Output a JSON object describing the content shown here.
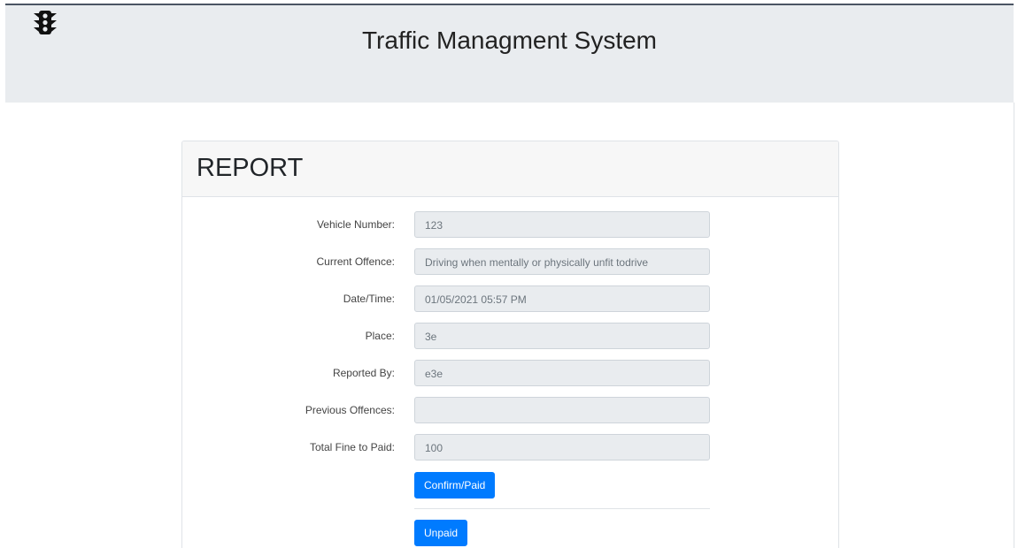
{
  "app": {
    "title": "Traffic Managment System",
    "logo_icon": "traffic-light-icon"
  },
  "report": {
    "title": "REPORT",
    "fields": [
      {
        "label": "Vehicle Number:",
        "value": "123"
      },
      {
        "label": "Current Offence:",
        "value": "Driving when mentally or physically unfit todrive"
      },
      {
        "label": "Date/Time:",
        "value": "01/05/2021 05:57 PM"
      },
      {
        "label": "Place:",
        "value": "3e"
      },
      {
        "label": "Reported By:",
        "value": "e3e"
      },
      {
        "label": "Previous Offences:",
        "value": ""
      },
      {
        "label": "Total Fine to Paid:",
        "value": "100"
      }
    ],
    "confirm_button": "Confirm/Paid",
    "unpaid_button": "Unpaid"
  },
  "colors": {
    "primary": "#007bff",
    "header_bg": "#e9ecef",
    "field_bg": "#e9ecef"
  }
}
